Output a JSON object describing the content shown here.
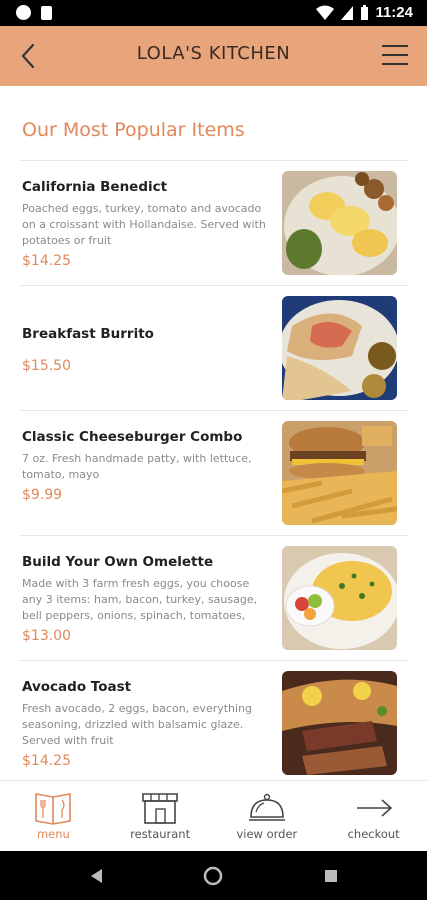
{
  "status_bar": {
    "time": "11:24"
  },
  "header": {
    "title": "LOLA'S KITCHEN"
  },
  "section": {
    "title": "Our Most Popular Items"
  },
  "items": [
    {
      "name": "California Benedict",
      "description": "Poached eggs, turkey, tomato and avocado on a croissant with Hollandaise. Served with potatoes or fruit",
      "price": "$14.25"
    },
    {
      "name": "Breakfast Burrito",
      "description": "",
      "price": "$15.50"
    },
    {
      "name": "Classic Cheeseburger Combo",
      "description": "7 oz. Fresh handmade patty, with lettuce, tomato, mayo",
      "price": "$9.99"
    },
    {
      "name": "Build Your Own Omelette",
      "description": "Made with 3 farm fresh eggs, you choose any 3 items: ham, bacon, turkey, sausage, bell peppers, onions, spinach, tomatoes,",
      "price": "$13.00"
    },
    {
      "name": "Avocado Toast",
      "description": "Fresh avocado, 2 eggs, bacon, everything seasoning, drizzled with balsamic glaze. Served with fruit",
      "price": "$14.25"
    }
  ],
  "bottom_nav": [
    {
      "label": "menu",
      "icon": "menu-book-icon",
      "active": true
    },
    {
      "label": "restaurant",
      "icon": "storefront-icon",
      "active": false
    },
    {
      "label": "view order",
      "icon": "cloche-icon",
      "active": false
    },
    {
      "label": "checkout",
      "icon": "arrow-right-icon",
      "active": false
    }
  ],
  "colors": {
    "header_bg": "#e8a57c",
    "accent": "#e0885a",
    "text_dark": "#222222",
    "text_muted": "#8a8a8a"
  }
}
